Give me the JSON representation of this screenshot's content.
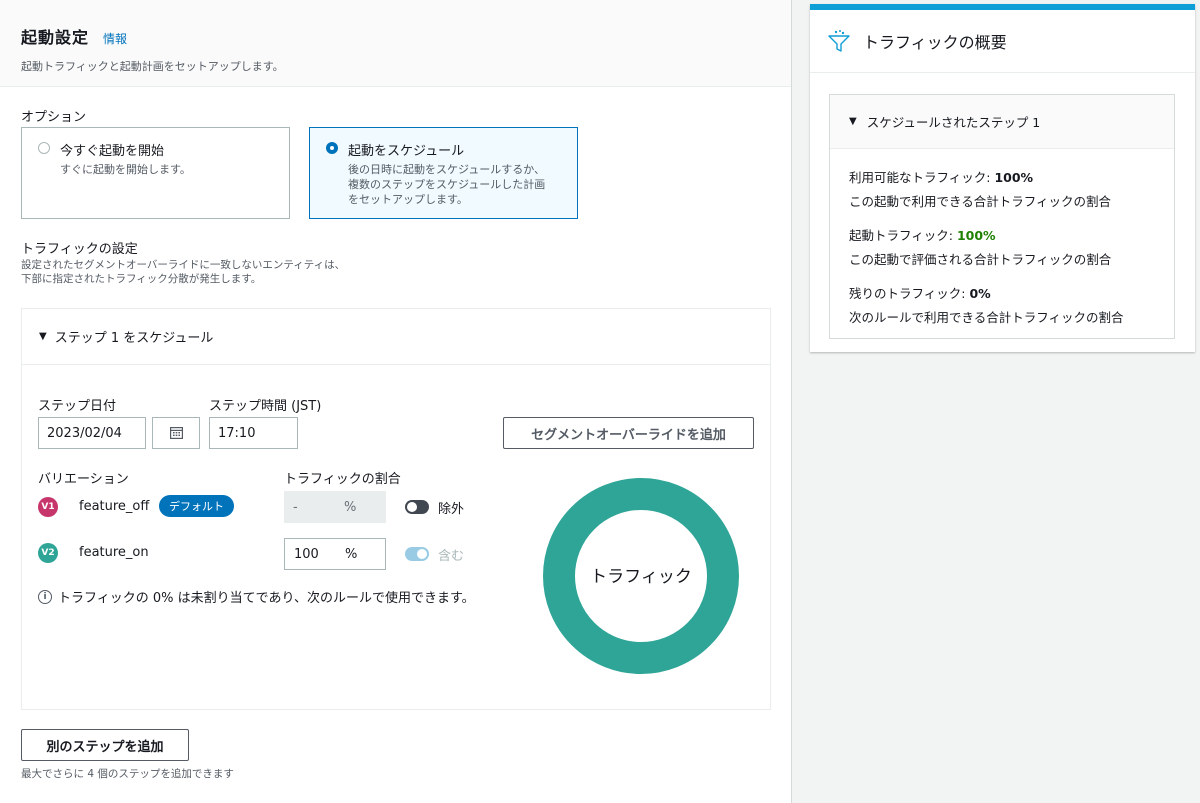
{
  "header": {
    "title": "起動設定",
    "info_link": "情報",
    "description": "起動トラフィックと起動計画をセットアップします。"
  },
  "options": {
    "label": "オプション",
    "items": [
      {
        "title": "今すぐ起動を開始",
        "desc": "すぐに起動を開始します。",
        "selected": false
      },
      {
        "title": "起動をスケジュール",
        "desc": "後の日時に起動をスケジュールするか、複数のステップをスケジュールした計画をセットアップします。",
        "desc_lines": [
          "後の日時に起動をスケジュールするか、",
          "複数のステップをスケジュールした計画",
          "をセットアップします。"
        ],
        "selected": true
      }
    ]
  },
  "traffic_settings": {
    "heading": "トラフィックの設定",
    "desc_line1": "設定されたセグメントオーバーライドに一致しないエンティティは、",
    "desc_line2": "下部に指定されたトラフィック分散が発生します。"
  },
  "step": {
    "header": "ステップ 1 をスケジュール",
    "date_label": "ステップ日付",
    "date_value": "2023/02/04",
    "time_label": "ステップ時間 (JST)",
    "time_value": "17:10",
    "segment_button": "セグメントオーバーライドを追加",
    "variation_header": "バリエーション",
    "traffic_header": "トラフィックの割合",
    "variations": [
      {
        "badge": "V1",
        "name": "feature_off",
        "tag": "デフォルト",
        "pct_value": "-",
        "unit": "%",
        "toggle_label": "除外",
        "toggle_on": false,
        "color": "#c7366b"
      },
      {
        "badge": "V2",
        "name": "feature_on",
        "pct_value": "100",
        "unit": "%",
        "toggle_label": "含む",
        "toggle_on": true,
        "color": "#2ea597"
      }
    ],
    "note": "トラフィックの 0% は未割り当てであり、次のルールで使用できます。",
    "donut_label": "トラフィック",
    "donut_color": "#2ea597"
  },
  "footer": {
    "add_step_button": "別のステップを追加",
    "add_step_hint": "最大でさらに 4 個のステップを追加できます"
  },
  "summary": {
    "title": "トラフィックの概要",
    "section": "スケジュールされたステップ 1",
    "items": [
      {
        "label": "利用可能なトラフィック: ",
        "value": "100%",
        "desc": "この起動で利用できる合計トラフィックの割合"
      },
      {
        "label": "起動トラフィック: ",
        "value": "100%",
        "desc": "この起動で評価される合計トラフィックの割合"
      },
      {
        "label": "残りのトラフィック: ",
        "value": "0%",
        "desc": "次のルールで利用できる合計トラフィックの割合"
      }
    ],
    "accent_color": "#0f9ed5",
    "highlight_color": "#1d8102"
  }
}
